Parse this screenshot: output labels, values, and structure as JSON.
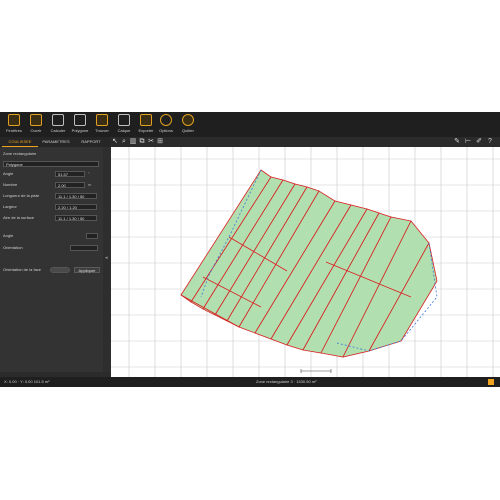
{
  "toolbar": {
    "items": [
      {
        "label": "Fenêtres",
        "icon": "measure-icon"
      },
      {
        "label": "Ouvrir",
        "icon": "open-icon"
      },
      {
        "label": "Calculer",
        "icon": "calculator-icon"
      },
      {
        "label": "Polygone",
        "icon": "polygon-icon"
      },
      {
        "label": "Trouver",
        "icon": "find-icon"
      },
      {
        "label": "Calque",
        "icon": "layer-icon"
      },
      {
        "label": "Exporter",
        "icon": "export-icon"
      },
      {
        "label": "Options",
        "icon": "gear-icon"
      },
      {
        "label": "Quitter",
        "icon": "power-icon"
      }
    ]
  },
  "tabs": {
    "items": [
      "COULISSEE",
      "PARAMETRES",
      "RAPPORT"
    ],
    "active": "COULISSEE"
  },
  "canvas_toolbar": {
    "left_icons": [
      "pointer-icon",
      "zoom-icon",
      "delete-icon",
      "copy-icon",
      "cut-icon",
      "grid-icon"
    ],
    "right_icons": [
      "ruler-icon",
      "dimension-icon",
      "pencil-icon",
      "help-icon"
    ]
  },
  "panel": {
    "header": "Zone rectangulaire",
    "select_value": "Polygone",
    "fields": [
      {
        "label": "Angle",
        "value": "51.57",
        "unit": "°"
      },
      {
        "label": "Nombre",
        "value": "2.00",
        "unit": "m"
      },
      {
        "label": "Longueur de la piste",
        "value": "11.1 / 1.30 / 50",
        "unit": ""
      },
      {
        "label": "Largeur",
        "value": "2.20 / 1.20",
        "unit": ""
      },
      {
        "label": "Aire de la surface",
        "value": "11.1 / 1.30 / 50",
        "unit": ""
      }
    ],
    "section_label": "Angle",
    "section_field": "Orientation",
    "toggle_label": "Orientation de la face",
    "toggle_button": "Appliquer"
  },
  "status_bar": {
    "left": "X: 0.00 · Y: 0.00  101.5 m²",
    "center": "Zone rectangulaire 3 · 1530.50 m²"
  },
  "colors": {
    "accent": "#f0a31f",
    "strip_fill": "#b2dfb0",
    "strip_stroke": "#d82020",
    "outline_dashed": "#3a7ad8"
  }
}
